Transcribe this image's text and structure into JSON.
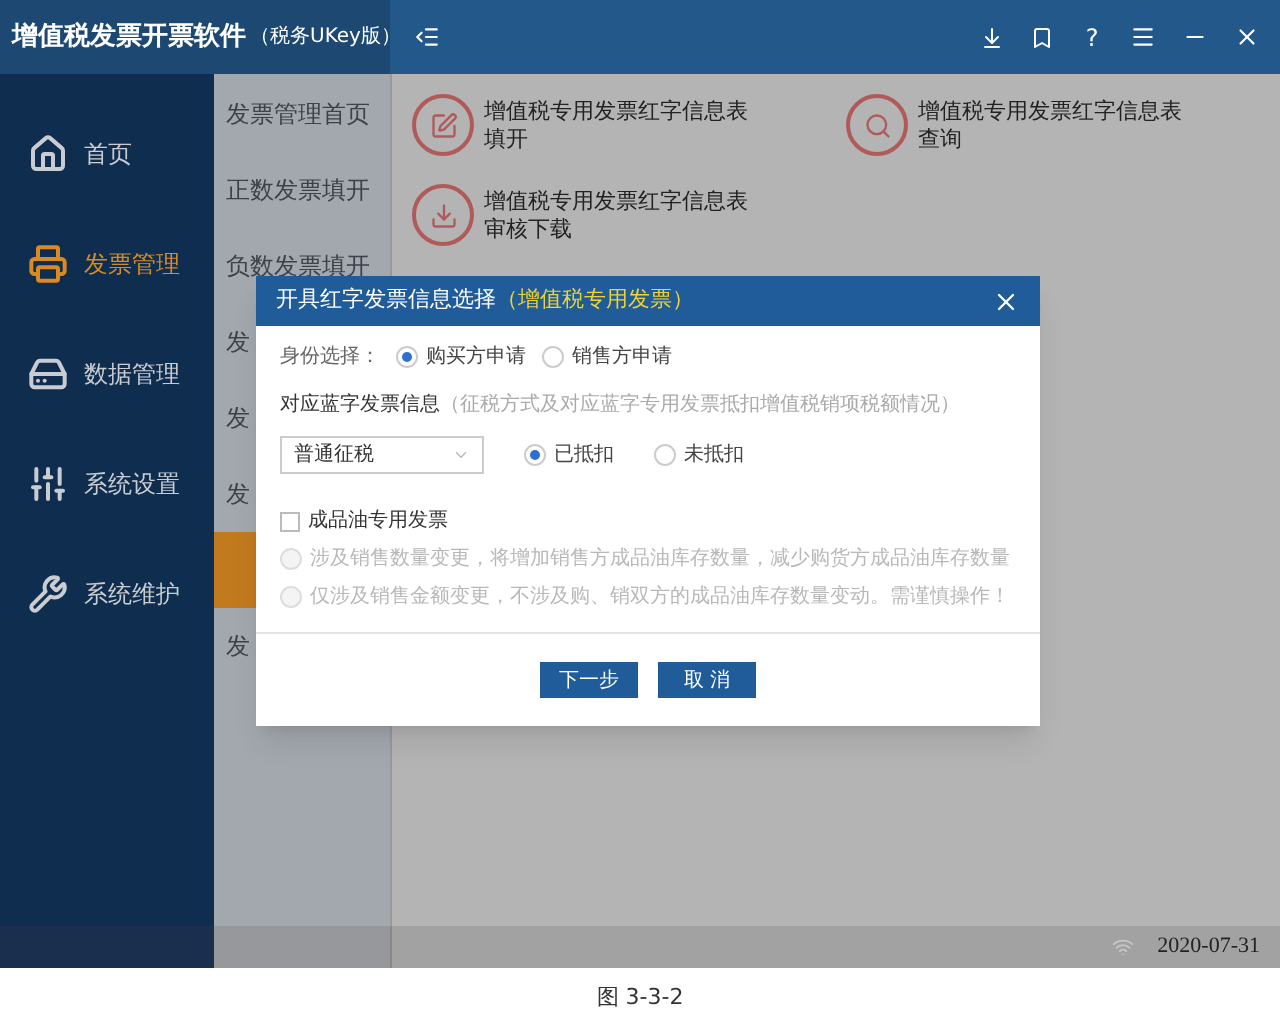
{
  "app": {
    "title": "增值税发票开票软件",
    "edition": "（税务UKey版）",
    "help_label": "?"
  },
  "sidebar": {
    "items": [
      {
        "label": "首页",
        "selected": false
      },
      {
        "label": "发票管理",
        "selected": true
      },
      {
        "label": "数据管理",
        "selected": false
      },
      {
        "label": "系统设置",
        "selected": false
      },
      {
        "label": "系统维护",
        "selected": false
      }
    ]
  },
  "subnav": {
    "items": [
      {
        "label": "发票管理首页",
        "selected": false
      },
      {
        "label": "正数发票填开",
        "selected": false
      },
      {
        "label": "负数发票填开",
        "selected": false
      },
      {
        "label": "发",
        "selected": false
      },
      {
        "label": "发",
        "selected": false
      },
      {
        "label": "发",
        "selected": false
      },
      {
        "selected": true
      },
      {
        "label": "发",
        "selected": false
      }
    ]
  },
  "tiles": [
    {
      "label": "增值税专用发票红字信息表填开"
    },
    {
      "label": "增值税专用发票红字信息表查询"
    },
    {
      "label": "增值税专用发票红字信息表审核下载"
    }
  ],
  "dialog": {
    "title": "开具红字发票信息选择",
    "subtitle": "（增值税专用发票）",
    "identity": {
      "label": "身份选择：",
      "options": [
        {
          "label": "购买方申请",
          "selected": true
        },
        {
          "label": "销售方申请",
          "selected": false
        }
      ]
    },
    "blue_invoice": {
      "label": "对应蓝字发票信息",
      "hint": "（征税方式及对应蓝字专用发票抵扣增值税销项税额情况）",
      "tax_method": "普通征税",
      "options": [
        {
          "label": "已抵扣",
          "selected": true
        },
        {
          "label": "未抵扣",
          "selected": false
        }
      ]
    },
    "oil": {
      "label": "成品油专用发票",
      "checked": false,
      "options": [
        {
          "label": "涉及销售数量变更，将增加销售方成品油库存数量，减少购货方成品油库存数量",
          "selected": false,
          "disabled": true
        },
        {
          "label": "仅涉及销售金额变更，不涉及购、销双方的成品油库存数量变动。需谨慎操作！",
          "selected": false,
          "disabled": true
        }
      ]
    },
    "buttons": [
      "下一步",
      "取 消"
    ]
  },
  "status_bar": {
    "date": "2020-07-31"
  },
  "caption": "图 3-3-2"
}
